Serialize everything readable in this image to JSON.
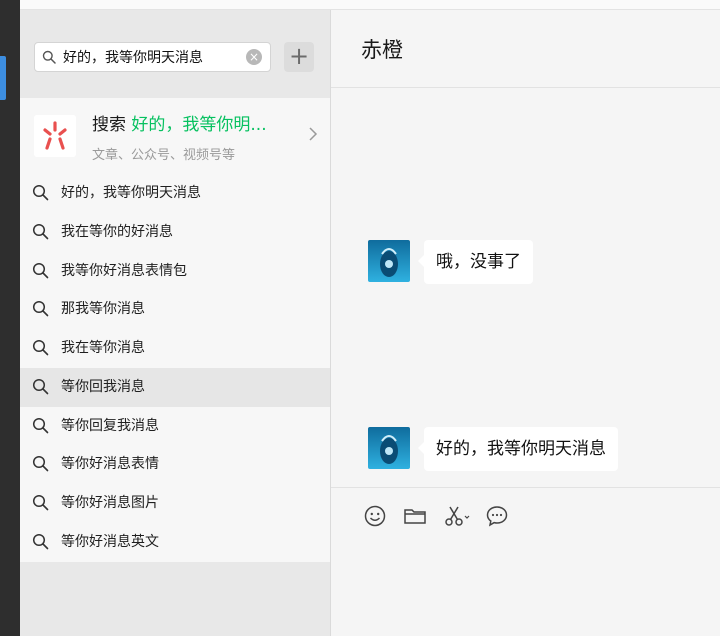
{
  "search": {
    "query": "好的，我等你明天消息",
    "clear_glyph": "×",
    "add_glyph": "+"
  },
  "web_search": {
    "prefix": "搜索",
    "highlight": "好的，我等你明...",
    "subtitle": "文章、公众号、视频号等",
    "logo_icon": "wechat-search-logo-icon",
    "accent_color": "#07c160",
    "logo_color": "#e9504f"
  },
  "suggestions": [
    {
      "label": "好的，我等你明天消息",
      "active": false
    },
    {
      "label": "我在等你的好消息",
      "active": false
    },
    {
      "label": "我等你好消息表情包",
      "active": false
    },
    {
      "label": "那我等你消息",
      "active": false
    },
    {
      "label": "我在等你消息",
      "active": false
    },
    {
      "label": "等你回我消息",
      "active": true
    },
    {
      "label": "等你回复我消息",
      "active": false
    },
    {
      "label": "等你好消息表情",
      "active": false
    },
    {
      "label": "等你好消息图片",
      "active": false
    },
    {
      "label": "等你好消息英文",
      "active": false
    }
  ],
  "chat": {
    "title": "赤橙",
    "messages": [
      {
        "text": "哦，没事了"
      },
      {
        "text": "好的，我等你明天消息"
      }
    ],
    "toolbar_icons": [
      "emoji-icon",
      "folder-icon",
      "scissors-icon",
      "chat-history-icon"
    ]
  }
}
